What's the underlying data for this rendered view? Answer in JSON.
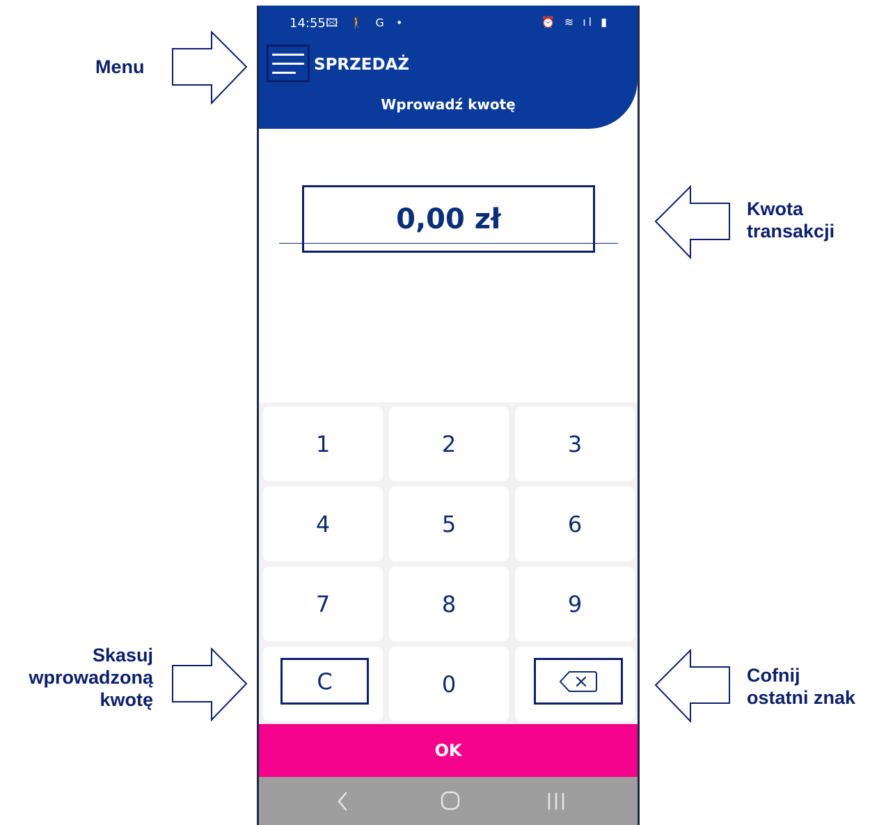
{
  "callouts": {
    "menu": "Menu",
    "amount_line1": "Kwota",
    "amount_line2": "transakcji",
    "clear_line1": "Skasuj",
    "clear_line2": "wprowadzoną",
    "clear_line3": "kwotę",
    "backspace_line1": "Cofnij",
    "backspace_line2": "ostatni znak"
  },
  "status_bar": {
    "time": "14:55",
    "left_icons": "🖾 🚶 G •",
    "right_icons": "⏰ ≋ ıl ▮"
  },
  "header": {
    "app_title": "SPRZEDAŻ",
    "subtitle": "Wprowadź kwotę"
  },
  "amount": {
    "value": "0,00 zł"
  },
  "keypad": {
    "keys": [
      "1",
      "2",
      "3",
      "4",
      "5",
      "6",
      "7",
      "8",
      "9",
      "C",
      "0"
    ],
    "backspace_icon": "backspace-icon"
  },
  "ok_button": {
    "label": "OK"
  },
  "nav_bar": {
    "back_icon": "chevron-left-icon",
    "home_icon": "home-circle-icon",
    "recents_icon": "recents-icon"
  },
  "colors": {
    "header_blue": "#0a3a9b",
    "annotation_navy": "#0d1f6b",
    "ok_pink": "#f5028c",
    "nav_gray": "#9e9e9e",
    "keypad_bg": "#f2f2f2"
  }
}
